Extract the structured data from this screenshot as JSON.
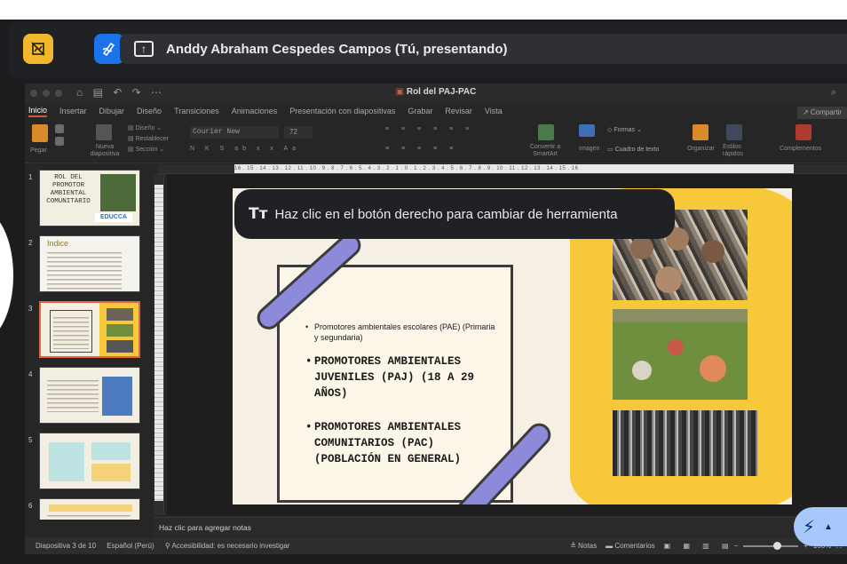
{
  "meet": {
    "presenter_label": "Anddy Abraham Cespedes Campos (Tú, presentando)",
    "buttons": [
      "annotation-off-icon",
      "pen-icon",
      "present-screen-icon"
    ],
    "colors": {
      "annotation_button": "#f2b72c",
      "pen_button": "#1a73e8",
      "bar": "#202124"
    }
  },
  "ppt": {
    "title": "Rol del PAJ-PAC",
    "tabs": [
      "Inicio",
      "Insertar",
      "Dibujar",
      "Diseño",
      "Transiciones",
      "Animaciones",
      "Presentación con diapositivas",
      "Grabar",
      "Revisar",
      "Vista"
    ],
    "active_tab": "Inicio",
    "share_label": "Compartir",
    "ribbon": {
      "paste": "Pegar",
      "new_slide": "Nueva diapositiva",
      "design": "Diseño",
      "reset": "Restablecer",
      "section": "Sección",
      "font_name": "Courier New",
      "font_size": "72",
      "convert_smartart": "Convertir a SmartArt",
      "image": "Imagen",
      "shapes": "Formas",
      "textbox": "Cuadro de texto",
      "arrange": "Organizar",
      "quick_styles": "Estilos rápidos",
      "addins": "Complementos"
    },
    "ruler_numbers": "16 . 15 . 14 . 13 . 12 . 11 . 10 . 9 . 8 . 7 . 6 . 5 . 4 . 3 . 2 . 1 . 0 . 1 . 2 . 3 . 4 . 5 . 6 . 7 . 8 . 9 . 10 . 11 . 12 . 13 . 14 . 15 . 16",
    "thumbnails": [
      {
        "num": "1",
        "title": "ROL DEL PROMOTOR AMBIENTAL COMUNITARIO",
        "badge": "EDUCCA"
      },
      {
        "num": "2",
        "title": "Indice"
      },
      {
        "num": "3",
        "title": ""
      },
      {
        "num": "4",
        "title": ""
      },
      {
        "num": "5",
        "title": ""
      },
      {
        "num": "6",
        "title": ""
      }
    ],
    "active_slide": 3,
    "slide": {
      "bullet_1": "Promotores ambientales escolares (PAE) (Primaria y segundaria)",
      "bullet_2": "PROMOTORES AMBIENTALES JUVENILES (PAJ) (18 A 29 AÑOS)",
      "bullet_3": "PROMOTORES AMBIENTALES COMUNITARIOS (PAC) (POBLACIÓN EN GENERAL)",
      "colors": {
        "background": "#f5f0e3",
        "blob": "#f6c83a",
        "tape": "#8c8ad9"
      }
    },
    "tooltip": {
      "icon": "Tт",
      "text": "Haz clic en el botón derecho para cambiar de herramienta"
    },
    "notes_placeholder": "Haz clic para agregar notas",
    "status": {
      "slide_info": "Diapositiva 3 de 10",
      "language": "Español (Perú)",
      "accessibility": "Accesibilidad: es necesario investigar",
      "notes": "Notas",
      "comments": "Comentarios",
      "zoom": "100%"
    }
  },
  "fab": {
    "icon": "pen-lightning-icon"
  }
}
